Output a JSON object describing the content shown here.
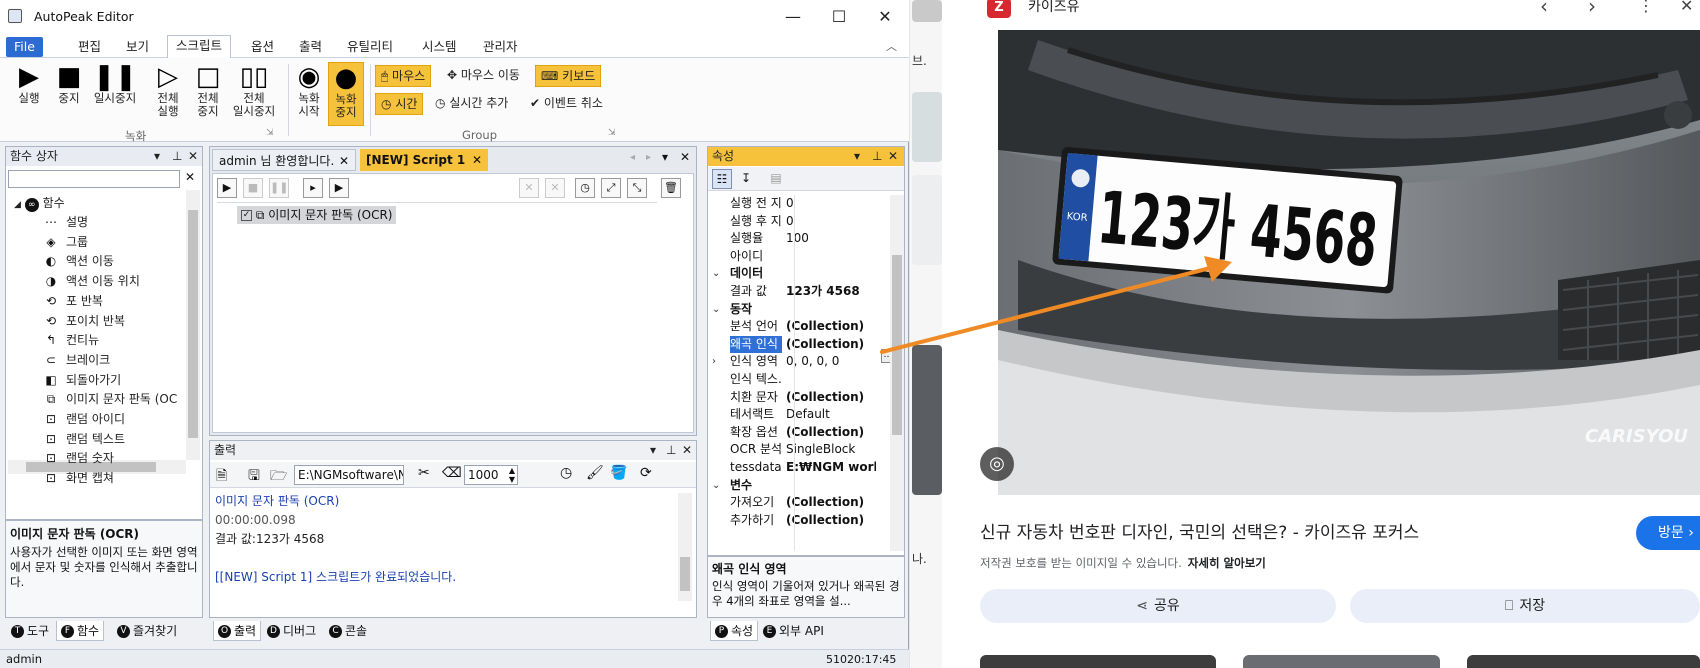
{
  "editor": {
    "title": "AutoPeak Editor",
    "window_controls": {
      "minimize": "—",
      "maximize": "☐",
      "close": "✕"
    },
    "menu": [
      "File",
      "편집",
      "보기",
      "스크립트",
      "옵션",
      "출력",
      "유틸리티",
      "시스템",
      "관리자"
    ],
    "active_menu": "스크립트",
    "ribbon": {
      "buttons": [
        {
          "label": "실행",
          "icon": "play-icon"
        },
        {
          "label": "중지",
          "icon": "stop-icon"
        },
        {
          "label": "일시중지",
          "icon": "pause-icon"
        },
        {
          "label": "전체\n실행",
          "icon": "play-all-icon"
        },
        {
          "label": "전체\n중지",
          "icon": "stop-all-icon"
        },
        {
          "label": "전체\n일시중지",
          "icon": "pause-all-icon"
        },
        {
          "label": "녹화\n시작",
          "icon": "record-start-icon"
        },
        {
          "label": "녹화\n중지",
          "icon": "record-stop-icon"
        }
      ],
      "small": [
        {
          "label": "마우스",
          "icon": "mouse-icon",
          "selected": true
        },
        {
          "label": "마우스 이동",
          "icon": "mouse-move-icon",
          "selected": false
        },
        {
          "label": "키보드",
          "icon": "keyboard-icon",
          "selected": true
        },
        {
          "label": "시간",
          "icon": "clock-icon",
          "selected": true
        },
        {
          "label": "실시간 추가",
          "icon": "realtime-add-icon",
          "selected": false
        },
        {
          "label": "이벤트 취소",
          "icon": "event-cancel-icon",
          "selected": false
        }
      ],
      "group_record": "녹화",
      "group_group": "Group"
    },
    "function_box": {
      "title": "함수 상자",
      "root": "함수",
      "items": [
        "설명",
        "그룹",
        "액션 이동",
        "액션 이동 위치",
        "포 반복",
        "포이치 반복",
        "컨티뉴",
        "브레이크",
        "되돌아가기",
        "이미지 문자 판독 (OC",
        "랜덤 아이디",
        "랜덤 텍스트",
        "랜덤 숫자",
        "화면 캡쳐"
      ],
      "desc_title": "이미지 문자 판독 (OCR)",
      "desc_text": "사용자가 선택한 이미지 또는 화면 영역에서 문자 및 숫자를 인식해서 추출합니다.",
      "bottom_tabs": [
        {
          "key": "T",
          "label": "도구"
        },
        {
          "key": "F",
          "label": "함수"
        },
        {
          "key": "V",
          "label": "즐겨찾기"
        }
      ]
    },
    "doc_tabs": [
      {
        "label": "admin 님 환영합니다.",
        "close": "✕"
      },
      {
        "label": "[NEW] Script 1",
        "close": "✕"
      }
    ],
    "script_item": "이미지 문자 판독 (OCR)",
    "output": {
      "title": "출력",
      "path": "E:\\NGMsoftware\\NG",
      "number": "1000",
      "lines": [
        {
          "text": "이미지 문자 판독 (OCR)",
          "color": "#1a3fb0"
        },
        {
          "text": "00:00:00.098",
          "color": "#555555"
        },
        {
          "text": "결과 값:123가 4568",
          "color": "#222222"
        },
        {
          "text": "",
          "color": "#222222"
        },
        {
          "text": "[[NEW] Script 1] 스크립트가 완료되었습니다.",
          "color": "#1a3fb0"
        }
      ],
      "bottom_tabs": [
        {
          "key": "O",
          "label": "출력"
        },
        {
          "key": "D",
          "label": "디버그"
        },
        {
          "key": "C",
          "label": "콘솔"
        }
      ]
    },
    "properties": {
      "title": "속성",
      "rows": [
        {
          "name": "실행 전 지",
          "value": "0",
          "type": "row"
        },
        {
          "name": "실행 후 지",
          "value": "0",
          "type": "row"
        },
        {
          "name": "실행율",
          "value": "100",
          "type": "row"
        },
        {
          "name": "아이디",
          "value": "",
          "type": "row"
        },
        {
          "name": "데이터",
          "value": "",
          "type": "cat"
        },
        {
          "name": "결과 값",
          "value": "123가 4568",
          "type": "bold"
        },
        {
          "name": "동작",
          "value": "",
          "type": "cat"
        },
        {
          "name": "분석 언어",
          "value": "(Collection)",
          "type": "bold"
        },
        {
          "name": "왜곡 인식",
          "value": "(Collection)",
          "type": "sel"
        },
        {
          "name": "인식 영역",
          "value": "0, 0, 0, 0",
          "type": "exp"
        },
        {
          "name": "인식 텍스.",
          "value": "",
          "type": "row"
        },
        {
          "name": "치환 문자",
          "value": "(Collection)",
          "type": "bold"
        },
        {
          "name": "테서랙트",
          "value": "Default",
          "type": "row"
        },
        {
          "name": "확장 옵션",
          "value": "(Collection)",
          "type": "bold"
        },
        {
          "name": "OCR 분석",
          "value": "SingleBlock",
          "type": "row"
        },
        {
          "name": "tessdata",
          "value": "E:₩NGM work p",
          "type": "bold"
        },
        {
          "name": "변수",
          "value": "",
          "type": "cat"
        },
        {
          "name": "가져오기",
          "value": "(Collection)",
          "type": "bold"
        },
        {
          "name": "추가하기",
          "value": "(Collection)",
          "type": "bold"
        }
      ],
      "desc_title": "왜곡 인식 영역",
      "desc_text": "인식 영역이 기울어져 있거나 왜곡된 경우 4개의 좌표로 영역을 설...",
      "bottom_tabs": [
        {
          "key": "P",
          "label": "속성"
        },
        {
          "key": "E",
          "label": "외부 API"
        }
      ]
    },
    "status": {
      "user": "admin",
      "right": "51020:17:45"
    }
  },
  "browser": {
    "site_name": "카이즈유",
    "image_title": "신규 자동차 번호판 디자인, 국민의 선택은? - 카이즈유 포커스",
    "copyright": "저작권 보호를 받는 이미지일 수 있습니다.",
    "learn_more": "자세히 알아보기",
    "visit": "방문",
    "share": "공유",
    "save": "저장",
    "plate_text": "123가 4568",
    "plate_kor": "KOR",
    "watermark": "CARISYOU",
    "left_strip_text": [
      "브.",
      "나."
    ]
  },
  "colors": {
    "accent": "#f6c23c",
    "file_menu": "#2b6bd2",
    "arrow": "#f08a24",
    "visit_button": "#1a73e8"
  }
}
